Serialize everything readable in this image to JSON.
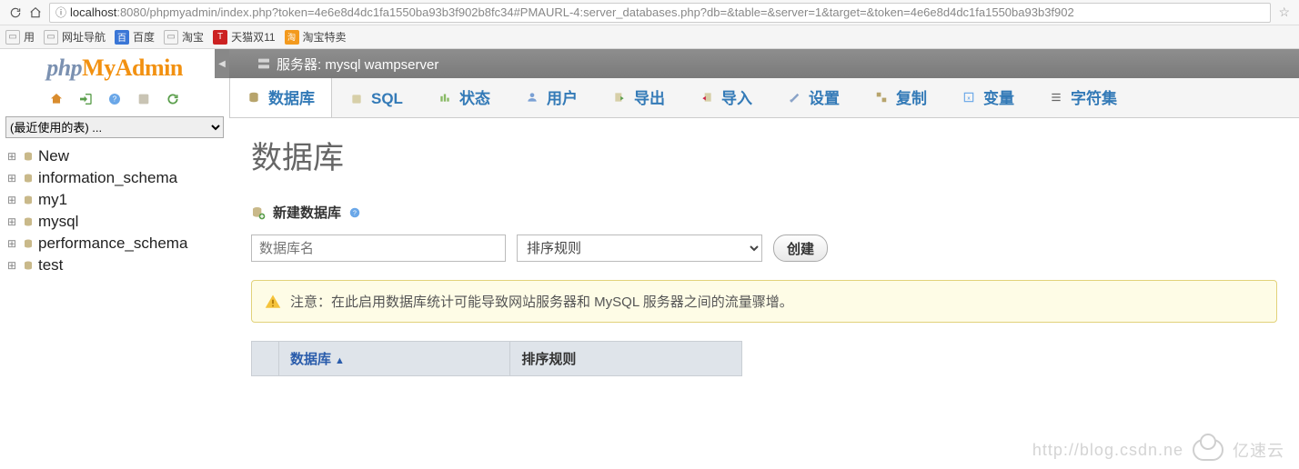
{
  "browser": {
    "url_host": "localhost",
    "url_port": ":8080",
    "url_path": "/phpmyadmin/index.php?token=4e6e8d4dc1fa1550ba93b3f902b8fc34#PMAURL-4:server_databases.php?db=&table=&server=1&target=&token=4e6e8d4dc1fa1550ba93b3f902"
  },
  "bookmarks": [
    {
      "label": "用",
      "icon": "page"
    },
    {
      "label": "网址导航",
      "icon": "page"
    },
    {
      "label": "百度",
      "icon": "blue"
    },
    {
      "label": "淘宝",
      "icon": "page"
    },
    {
      "label": "天猫双11",
      "icon": "red"
    },
    {
      "label": "淘宝特卖",
      "icon": "orange"
    }
  ],
  "sidebar": {
    "recent_label": "(最近使用的表) ...",
    "nodes": [
      "New",
      "information_schema",
      "my1",
      "mysql",
      "performance_schema",
      "test"
    ]
  },
  "server_bar": {
    "label": "服务器: mysql wampserver"
  },
  "tabs": [
    {
      "label": "数据库",
      "icon": "db"
    },
    {
      "label": "SQL",
      "icon": "sql"
    },
    {
      "label": "状态",
      "icon": "status"
    },
    {
      "label": "用户",
      "icon": "user"
    },
    {
      "label": "导出",
      "icon": "export"
    },
    {
      "label": "导入",
      "icon": "import"
    },
    {
      "label": "设置",
      "icon": "settings"
    },
    {
      "label": "复制",
      "icon": "replication"
    },
    {
      "label": "变量",
      "icon": "vars"
    },
    {
      "label": "字符集",
      "icon": "charset"
    }
  ],
  "content": {
    "title": "数据库",
    "create_label": "新建数据库",
    "dbname_placeholder": "数据库名",
    "collation_placeholder": "排序规则",
    "create_btn": "创建",
    "notice": "注意：在此启用数据库统计可能导致网站服务器和 MySQL 服务器之间的流量骤增。",
    "th_db": "数据库",
    "th_collation": "排序规则"
  },
  "watermark": {
    "text": "http://blog.csdn.ne",
    "brand": "亿速云"
  }
}
